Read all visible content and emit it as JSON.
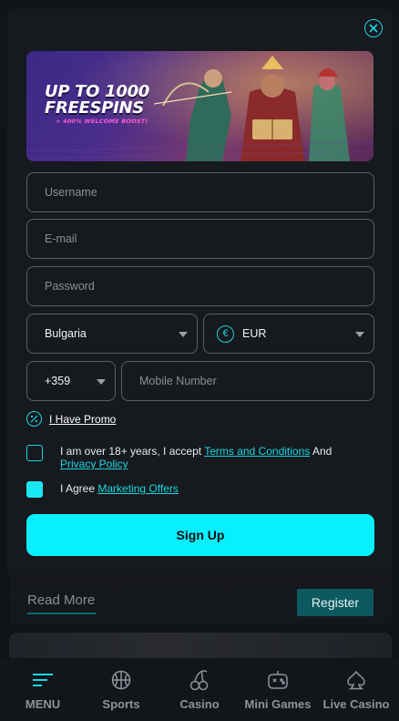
{
  "background": {
    "read_more": "Read More",
    "register": "Register"
  },
  "banner": {
    "headline_line1": "UP TO 1000",
    "headline_line2": "FREESPINS",
    "subline": "+ 400% WELCOME BOOST!"
  },
  "form": {
    "username_placeholder": "Username",
    "email_placeholder": "E-mail",
    "password_placeholder": "Password",
    "country_value": "Bulgaria",
    "currency_value": "EUR",
    "phone_code_value": "+359",
    "mobile_placeholder": "Mobile Number",
    "promo_label": "I Have Promo",
    "age_text_prefix": "I am over 18+ years, I accept ",
    "age_terms_link": "Terms and Conditions",
    "age_text_and": " And",
    "age_privacy_link": "Privacy Policy",
    "marketing_prefix": "I Agree ",
    "marketing_link": "Marketing Offers",
    "age_checked": false,
    "marketing_checked": true,
    "submit_label": "Sign Up"
  },
  "colors": {
    "accent": "#08f0fd",
    "modal_bg": "#16191d",
    "page_bg": "#0c1014"
  },
  "nav": {
    "items": [
      {
        "label": "MENU",
        "icon": "menu-icon"
      },
      {
        "label": "Sports",
        "icon": "basketball-icon"
      },
      {
        "label": "Casino",
        "icon": "cherries-icon"
      },
      {
        "label": "Mini Games",
        "icon": "gamepad-icon"
      },
      {
        "label": "Live Casino",
        "icon": "spade-icon"
      }
    ]
  }
}
